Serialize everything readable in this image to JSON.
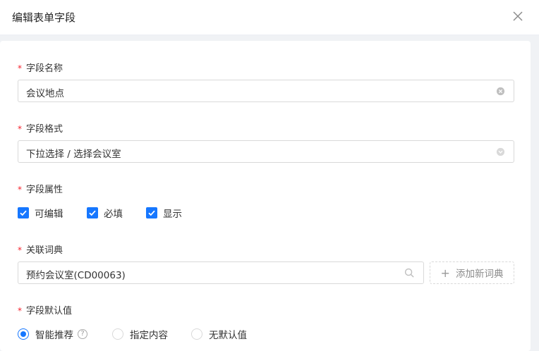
{
  "dialog": {
    "title": "编辑表单字段"
  },
  "fields": {
    "name": {
      "label": "字段名称",
      "value": "会议地点"
    },
    "format": {
      "label": "字段格式",
      "value": "下拉选择 / 选择会议室"
    },
    "attributes": {
      "label": "字段属性",
      "options": [
        {
          "label": "可编辑",
          "checked": true
        },
        {
          "label": "必填",
          "checked": true
        },
        {
          "label": "显示",
          "checked": true
        }
      ]
    },
    "dictionary": {
      "label": "关联词典",
      "value": "预约会议室(CD00063)",
      "add_label": "添加新词典"
    },
    "default_value": {
      "label": "字段默认值",
      "options": [
        {
          "label": "智能推荐",
          "selected": true
        },
        {
          "label": "指定内容",
          "selected": false
        },
        {
          "label": "无默认值",
          "selected": false
        }
      ]
    }
  },
  "required_mark": "*",
  "colors": {
    "primary": "#1677ff",
    "required": "#f5222d"
  }
}
